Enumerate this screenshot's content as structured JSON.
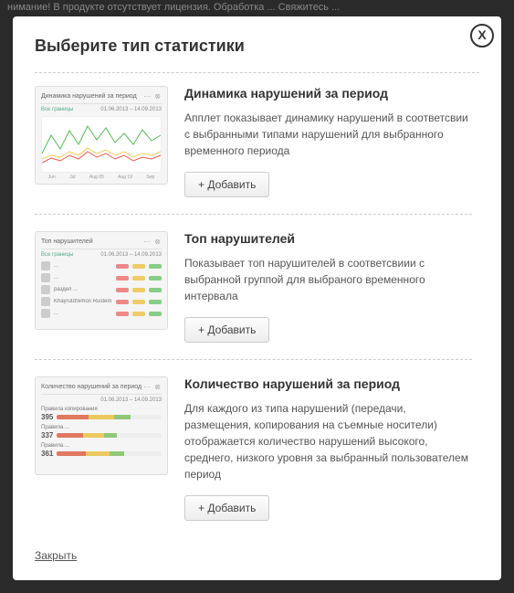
{
  "backdrop_text": "нимание! В продукте отсутствует лицензия. Обработка ... Свяжитесь ...",
  "close_icon": "X",
  "modal_title": "Выберите тип статистики",
  "add_label": "+ Добавить",
  "footer_close": "Закрыть",
  "cards": [
    {
      "title": "Динамика нарушений за период",
      "desc": "Апплет показывает динамику нарушений в соответсвии с выбранными типами нарушений для выбранного временного периода",
      "thumb_title": "Динамика нарушений за период",
      "thumb_date": "01.06.2013 – 14.09.2013",
      "thumb_tag": "Все границы"
    },
    {
      "title": "Топ нарушителей",
      "desc": "Показывает топ нарушителей в соответсвиии с выбранной группой для выбраного временного интервала",
      "thumb_title": "Топ нарушителей",
      "thumb_date": "01.06.2013 – 14.09.2013",
      "thumb_tag": "Все границы",
      "rows": [
        {
          "name": "..."
        },
        {
          "name": "..."
        },
        {
          "name": "раздел ..."
        },
        {
          "name": "KhayrutdSimon Rustem"
        },
        {
          "name": "..."
        }
      ]
    },
    {
      "title": "Количество нарушений за период",
      "desc": "Для каждого из типа нарушений (передачи, размещения, копирования на съемные носители) отображается количество нарушений высокого, среднего, низкого уровня за выбранный пользователем период",
      "thumb_title": "Количество нарушений за период",
      "thumb_date": "01.06.2013 – 14.09.2013",
      "bars": [
        {
          "label": "Правила копирования",
          "value": "395"
        },
        {
          "label": "Правила ...",
          "value": "337"
        },
        {
          "label": "Правила ...",
          "value": "361"
        }
      ]
    }
  ]
}
